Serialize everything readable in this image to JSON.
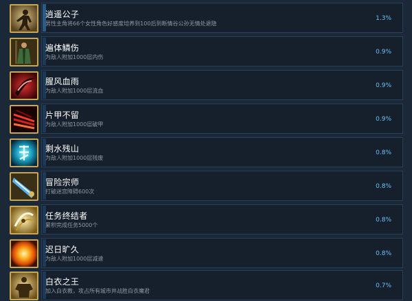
{
  "achievements": [
    {
      "icon": "silhouette-warrior-icon",
      "title": "逍遥公子",
      "desc": "男性主角将66个女性角色好感度培养到100后到断情谷公孙无情处退隐",
      "pct": "1.3%",
      "pct_value": 1.3
    },
    {
      "icon": "green-robed-figure-icon",
      "title": "遍体鳞伤",
      "desc": "为敌人附加1000层内伤",
      "pct": "0.9%",
      "pct_value": 0.9
    },
    {
      "icon": "red-blade-slash-icon",
      "title": "腥风血雨",
      "desc": "为敌人附加1000层流血",
      "pct": "0.9%",
      "pct_value": 0.9
    },
    {
      "icon": "red-claw-strike-icon",
      "title": "片甲不留",
      "desc": "为敌人附加1000层破甲",
      "pct": "0.9%",
      "pct_value": 0.9
    },
    {
      "icon": "cyan-rune-burst-icon",
      "title": "剩水残山",
      "desc": "为敌人附加1000层残废",
      "pct": "0.8%",
      "pct_value": 0.8
    },
    {
      "icon": "blue-beam-icon",
      "title": "冒险宗师",
      "desc": "打破迷宫障碍600次",
      "pct": "0.8%",
      "pct_value": 0.8
    },
    {
      "icon": "golden-spin-strike-icon",
      "title": "任务终结者",
      "desc": "累积完成任务5000个",
      "pct": "0.8%",
      "pct_value": 0.8
    },
    {
      "icon": "fire-sun-icon",
      "title": "迟日旷久",
      "desc": "为敌人附加1000层减速",
      "pct": "0.8%",
      "pct_value": 0.8
    },
    {
      "icon": "muscular-figure-icon",
      "title": "白衣之王",
      "desc": "加入白衣教，攻占所有城市并战胜白衣魔君",
      "pct": "0.7%",
      "pct_value": 0.7
    }
  ]
}
